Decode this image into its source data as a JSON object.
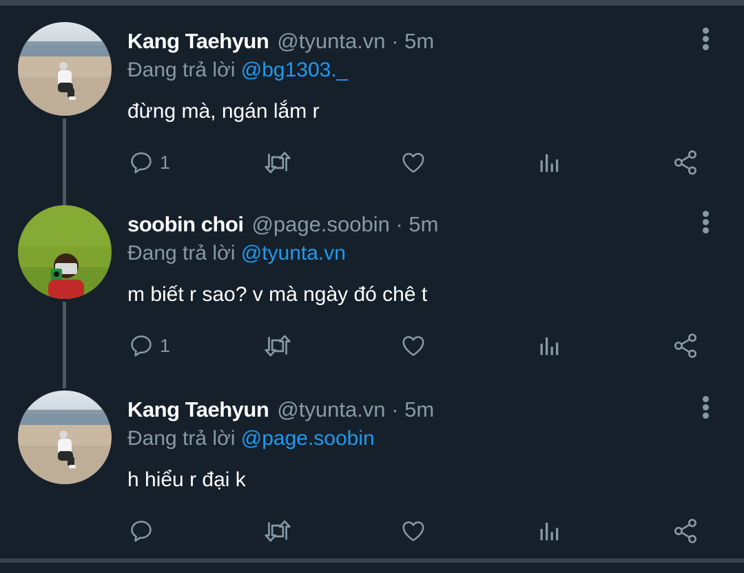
{
  "tweets": [
    {
      "name": "Kang Taehyun",
      "handle": "@tyunta.vn",
      "dot": "·",
      "time": "5m",
      "replying_prefix": "Đang trả lời",
      "replying_to": "@bg1303._",
      "text": "đừng mà, ngán lắm r",
      "reply_count": "1",
      "avatar": "beach-photo"
    },
    {
      "name": "soobin choi",
      "handle": "@page.soobin",
      "dot": "·",
      "time": "5m",
      "replying_prefix": "Đang trả lời",
      "replying_to": "@tyunta.vn",
      "text": "m biết r sao? v mà ngày đó chê t",
      "reply_count": "1",
      "avatar": "grass-camera-photo"
    },
    {
      "name": "Kang Taehyun",
      "handle": "@tyunta.vn",
      "dot": "·",
      "time": "5m",
      "replying_prefix": "Đang trả lời",
      "replying_to": "@page.soobin",
      "text": "h hiểu r đại k",
      "reply_count": "",
      "avatar": "beach-photo"
    }
  ],
  "icons": {
    "reply": "reply-icon",
    "retweet": "retweet-icon",
    "like": "heart-icon",
    "stats": "stats-icon",
    "share": "share-icon",
    "more": "more-options-icon"
  },
  "colors": {
    "background": "#15202b",
    "secondary_text": "#8899a6",
    "mention": "#1d9bf0",
    "thread_line": "#4b5863"
  }
}
